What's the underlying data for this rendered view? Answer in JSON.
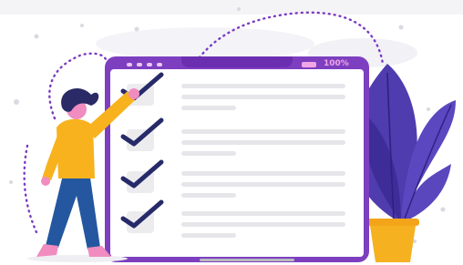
{
  "tablet": {
    "status_label": "100%",
    "checklist_items": [
      {
        "checked": true
      },
      {
        "checked": true
      },
      {
        "checked": true
      },
      {
        "checked": true
      }
    ]
  },
  "colors": {
    "tablet_frame": "#7d3fbf",
    "check_mark": "#272a69",
    "shirt": "#f7b21e",
    "jeans": "#24579f",
    "hair": "#2a2a66",
    "skin": "#f08cc0",
    "plant": "#4f3cae",
    "pot": "#f5b120",
    "dotted_path": "#7a3ac2"
  },
  "icons": [
    "check-icon",
    "plant-illustration",
    "person-illustration",
    "tablet-illustration"
  ]
}
